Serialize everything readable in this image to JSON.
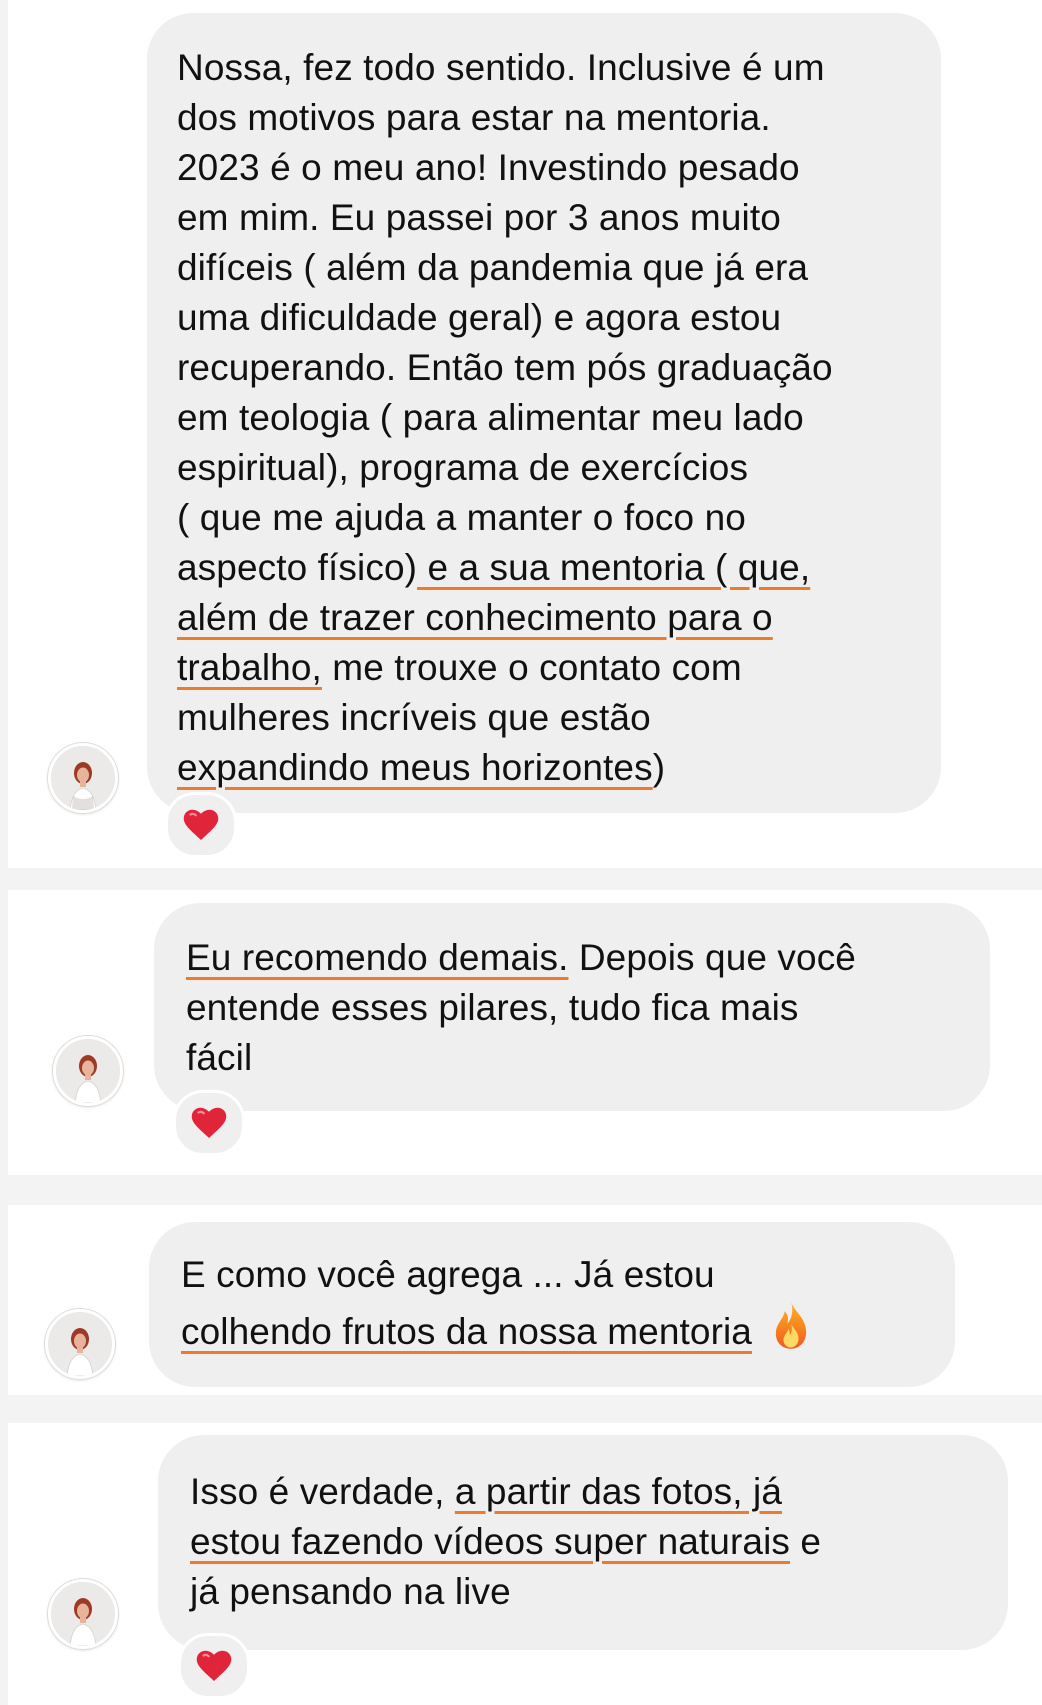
{
  "messages": [
    {
      "id": "m1",
      "lines": [
        [
          {
            "t": "Nossa, fez todo sentido. Inclusive é um"
          }
        ],
        [
          {
            "t": "dos motivos para estar na mentoria."
          }
        ],
        [
          {
            "t": "2023 é o meu ano! Investindo pesado"
          }
        ],
        [
          {
            "t": "em mim. Eu passei por 3 anos muito"
          }
        ],
        [
          {
            "t": "difíceis ( além da pandemia que já era"
          }
        ],
        [
          {
            "t": "uma dificuldade geral) e agora estou"
          }
        ],
        [
          {
            "t": "recuperando. Então tem pós graduação"
          }
        ],
        [
          {
            "t": "em teologia ( para alimentar meu lado"
          }
        ],
        [
          {
            "t": "espiritual), programa de exercícios"
          }
        ],
        [
          {
            "t": "( que me ajuda a manter o foco no"
          }
        ],
        [
          {
            "t": "aspecto físico)"
          },
          {
            "t": " e a sua mentoria ( que,",
            "u": true
          }
        ],
        [
          {
            "t": "além de trazer conhecimento para o",
            "u": true
          }
        ],
        [
          {
            "t": "trabalho,",
            "u": true
          },
          {
            "t": " me trouxe o contato com"
          }
        ],
        [
          {
            "t": "mulheres incríveis que estão"
          }
        ],
        [
          {
            "t": "expandindo meus horizontes",
            "u": true
          },
          {
            "t": ")"
          }
        ]
      ],
      "reaction": "heart"
    },
    {
      "id": "m2",
      "lines": [
        [
          {
            "t": "Eu recomendo demais.",
            "u": true
          },
          {
            "t": " Depois que você"
          }
        ],
        [
          {
            "t": "entende esses pilares, tudo fica mais"
          }
        ],
        [
          {
            "t": "fácil"
          }
        ]
      ],
      "reaction": "heart"
    },
    {
      "id": "m3",
      "lines": [
        [
          {
            "t": "E como você agrega ... Já estou"
          }
        ],
        [
          {
            "t": "colhendo frutos da nossa mentoria",
            "u": true
          }
        ]
      ],
      "trailing_emoji": "fire",
      "reaction": null
    },
    {
      "id": "m4",
      "lines": [
        [
          {
            "t": "Isso é verdade, "
          },
          {
            "t": "a partir das fotos, já",
            "u": true
          }
        ],
        [
          {
            "t": "estou fazendo vídeos super naturais",
            "u": true
          },
          {
            "t": " e"
          }
        ],
        [
          {
            "t": "já pensando na live"
          }
        ]
      ],
      "reaction": "heart"
    }
  ],
  "colors": {
    "page_bg": "#f3f3f3",
    "card_bg": "#ffffff",
    "bubble_bg": "#efeff0",
    "highlight_underline": "#ef7a2a",
    "heart": "#e0243a"
  },
  "icons": {
    "reaction": "heart-icon",
    "trailing": "fire-icon",
    "avatar": "profile-avatar"
  }
}
